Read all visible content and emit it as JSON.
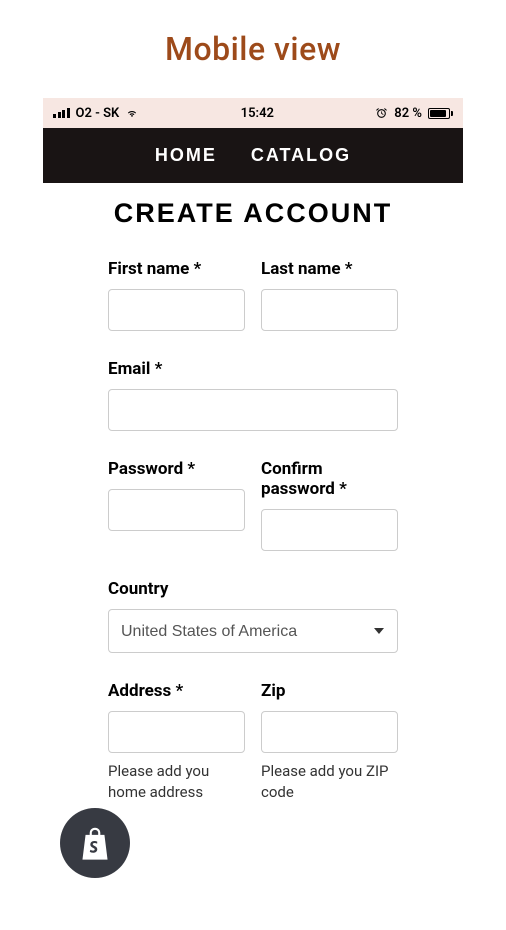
{
  "page_title": "Mobile view",
  "status_bar": {
    "carrier": "O2 - SK",
    "time": "15:42",
    "battery_percent": "82 %"
  },
  "nav": {
    "home": "HOME",
    "catalog": "CATALOG"
  },
  "form": {
    "title": "CREATE ACCOUNT",
    "first_name_label": "First name *",
    "last_name_label": "Last name *",
    "email_label": "Email *",
    "password_label": "Password *",
    "confirm_password_label": "Confirm password *",
    "country_label": "Country",
    "country_value": "United States of America",
    "address_label": "Address *",
    "address_helper": "Please add you home address",
    "zip_label": "Zip",
    "zip_helper": "Please add you ZIP code"
  }
}
